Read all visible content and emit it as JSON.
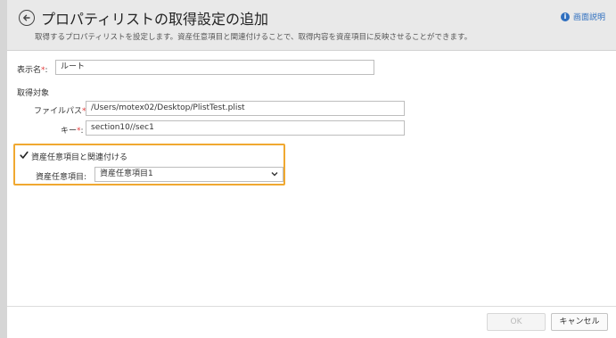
{
  "header": {
    "title": "プロパティリストの取得設定の追加",
    "subtitle": "取得するプロパティリストを設定します。資産任意項目と関連付けることで、取得内容を資産項目に反映させることができます。",
    "help_label": "画面説明"
  },
  "form": {
    "display_name": {
      "label": "表示名",
      "required_mark": "*",
      "suffix": ":",
      "value": "ルート"
    },
    "target_section_label": "取得対象",
    "file_path": {
      "label": "ファイルパス",
      "required_mark": "*",
      "suffix": ":",
      "value": "/Users/motex02/Desktop/PlistTest.plist"
    },
    "key": {
      "label": "キー",
      "required_mark": "*",
      "suffix": ":",
      "value": "section10//sec1"
    },
    "link_checkbox": {
      "label": "資産任意項目と関連付ける",
      "checked": true
    },
    "asset_item": {
      "label": "資産任意項目:",
      "selected": "資産任意項目1"
    }
  },
  "footer": {
    "ok_label": "OK",
    "cancel_label": "キャンセル"
  },
  "colors": {
    "accent_highlight": "#f0a830",
    "required": "#e23b3b",
    "link": "#2f6fbf"
  }
}
